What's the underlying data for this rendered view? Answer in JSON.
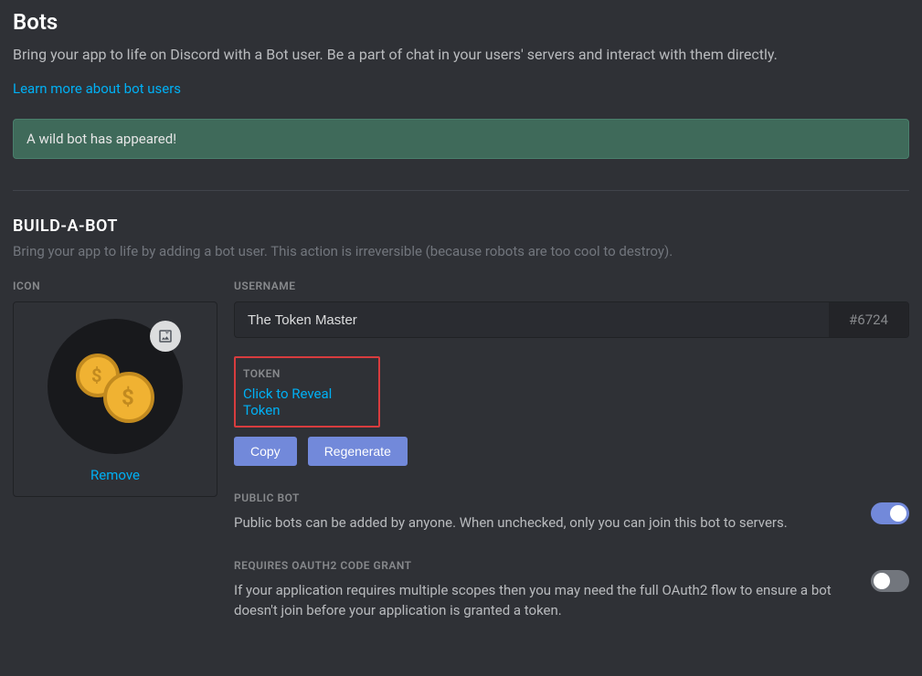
{
  "page": {
    "title": "Bots",
    "description": "Bring your app to life on Discord with a Bot user. Be a part of chat in your users' servers and interact with them directly.",
    "learn_more": "Learn more about bot users"
  },
  "alert": {
    "text": "A wild bot has appeared!"
  },
  "build": {
    "title": "BUILD-A-BOT",
    "description": "Bring your app to life by adding a bot user. This action is irreversible (because robots are too cool to destroy)."
  },
  "icon": {
    "label": "ICON",
    "remove": "Remove"
  },
  "username": {
    "label": "USERNAME",
    "value": "The Token Master",
    "discriminator": "#6724"
  },
  "token": {
    "label": "TOKEN",
    "reveal": "Click to Reveal Token",
    "copy": "Copy",
    "regenerate": "Regenerate"
  },
  "public_bot": {
    "label": "PUBLIC BOT",
    "description": "Public bots can be added by anyone. When unchecked, only you can join this bot to servers.",
    "enabled": true
  },
  "oauth2": {
    "label": "REQUIRES OAUTH2 CODE GRANT",
    "description": "If your application requires multiple scopes then you may need the full OAuth2 flow to ensure a bot doesn't join before your application is granted a token.",
    "enabled": false
  }
}
